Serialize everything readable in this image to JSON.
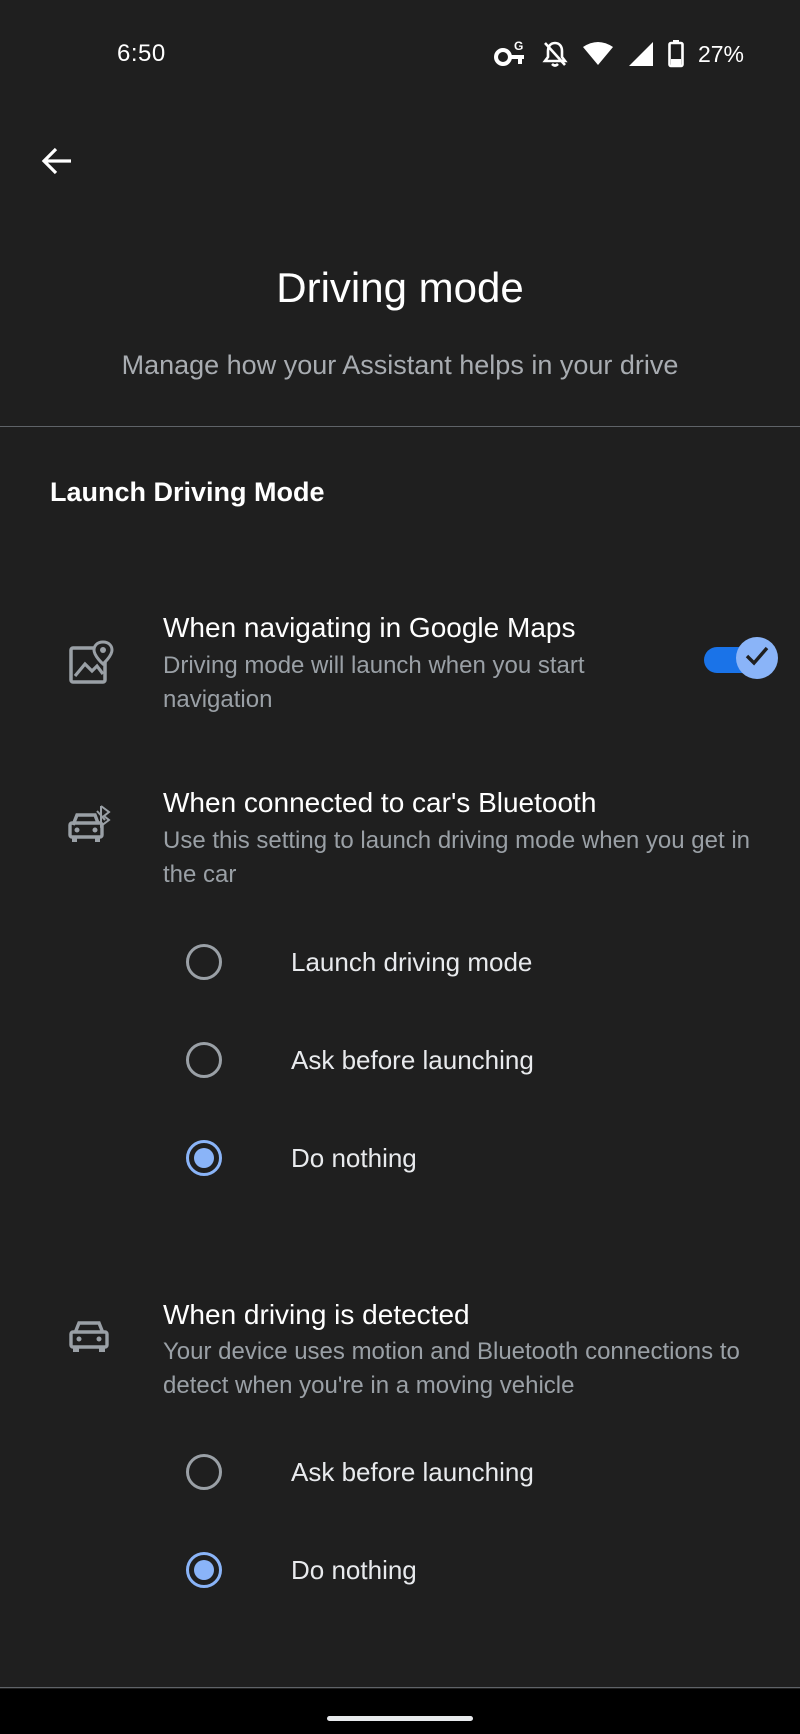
{
  "status_bar": {
    "time": "6:50",
    "icons": [
      "vpn-key-icon",
      "notifications-off-icon",
      "wifi-icon",
      "cell-signal-icon",
      "battery-icon"
    ],
    "battery": "27%"
  },
  "header": {
    "back_icon": "arrow-back-icon",
    "title": "Driving mode",
    "subtitle": "Manage how your Assistant helps in your drive"
  },
  "section": {
    "heading": "Launch Driving Mode"
  },
  "settings": [
    {
      "icon": "map-pin-icon",
      "title": "When navigating in Google Maps",
      "description": "Driving mode will launch when you start navigation",
      "toggle_on": true
    },
    {
      "icon": "car-bluetooth-icon",
      "title": "When connected to car's Bluetooth",
      "description": "Use this setting to launch driving mode when you get in the car",
      "options": [
        {
          "label": "Launch driving mode",
          "selected": false
        },
        {
          "label": "Ask before launching",
          "selected": false
        },
        {
          "label": "Do nothing",
          "selected": true
        }
      ]
    },
    {
      "icon": "car-icon",
      "title": "When driving is detected",
      "description": "Your device uses motion and Bluetooth connections to detect when you're in a moving vehicle",
      "options": [
        {
          "label": "Ask before launching",
          "selected": false
        },
        {
          "label": "Do nothing",
          "selected": true
        }
      ]
    }
  ],
  "colors": {
    "background": "#1f1f1f",
    "accent": "#8ab4f8",
    "toggle_track": "#1a73e8",
    "secondary_text": "#9aa0a6"
  }
}
